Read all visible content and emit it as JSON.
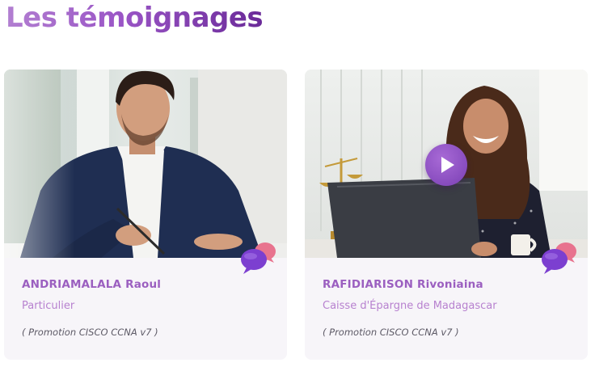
{
  "section": {
    "title": "Les témoignages"
  },
  "testimonials": [
    {
      "name": "ANDRIAMALALA Raoul",
      "role": "Particulier",
      "promotion": "( Promotion CISCO CCNA v7 )",
      "photo_icon": "man-writing-photo",
      "has_video": false
    },
    {
      "name": "RAFIDIARISON Rivoniaina",
      "role": "Caisse d'Épargne de Madagascar",
      "promotion": "( Promotion CISCO CCNA v7 )",
      "photo_icon": "woman-laptop-photo",
      "has_video": true
    }
  ],
  "colors": {
    "title_gradient": [
      "#b27fd1",
      "#6a2a98"
    ],
    "name": "#9b5fc0",
    "role": "#b781cf",
    "card_bg": "#f7f5f9",
    "play_button": "#8a4cc4"
  }
}
